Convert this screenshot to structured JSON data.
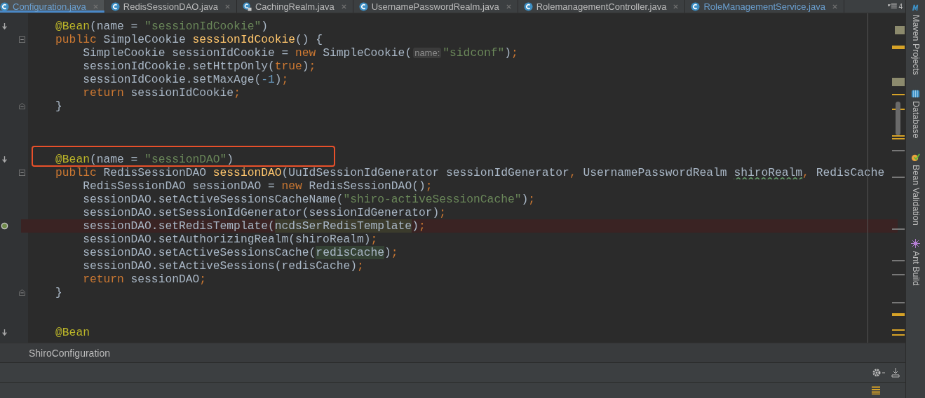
{
  "tabs": [
    {
      "label": "Configuration.java",
      "selected": true,
      "kind": "class",
      "modified": true
    },
    {
      "label": "RedisSessionDAO.java",
      "selected": false,
      "kind": "class",
      "modified": false
    },
    {
      "label": "CachingRealm.java",
      "selected": false,
      "kind": "locked-class",
      "modified": false
    },
    {
      "label": "UsernamePasswordRealm.java",
      "selected": false,
      "kind": "class",
      "modified": false
    },
    {
      "label": "RolemanagementController.java",
      "selected": false,
      "kind": "class",
      "modified": false
    },
    {
      "label": "RoleManagementService.java",
      "selected": false,
      "kind": "class",
      "modified": true
    }
  ],
  "hidden_tab_count": "4",
  "code_lines": [
    {
      "kind": "code",
      "override_marker": true,
      "bean_marker": false,
      "fold_start": false,
      "fold_end": false,
      "breakpoint": false,
      "boxed": false,
      "tokens": [
        {
          "kind": "annotation",
          "text": "    @Bean"
        },
        {
          "kind": "plain",
          "text": "(name = "
        },
        {
          "kind": "string",
          "text": "\"sessionIdCookie\""
        },
        {
          "kind": "plain",
          "text": ")"
        }
      ]
    },
    {
      "kind": "code",
      "override_marker": false,
      "bean_marker": false,
      "fold_start": true,
      "fold_end": false,
      "breakpoint": false,
      "boxed": false,
      "tokens": [
        {
          "kind": "keyword",
          "text": "    public "
        },
        {
          "kind": "plain",
          "text": "SimpleCookie "
        },
        {
          "kind": "method",
          "text": "sessionIdCookie"
        },
        {
          "kind": "plain",
          "text": "() {"
        }
      ]
    },
    {
      "kind": "code",
      "override_marker": false,
      "bean_marker": false,
      "fold_start": false,
      "fold_end": false,
      "breakpoint": false,
      "boxed": false,
      "tokens": [
        {
          "kind": "plain",
          "text": "        SimpleCookie sessionIdCookie = "
        },
        {
          "kind": "keyword",
          "text": "new "
        },
        {
          "kind": "plain",
          "text": "SimpleCookie("
        },
        {
          "kind": "hint",
          "text": "name:"
        },
        {
          "kind": "string",
          "text": "\"sidconf\""
        },
        {
          "kind": "plain",
          "text": ")"
        },
        {
          "kind": "keyword",
          "text": ";"
        }
      ]
    },
    {
      "kind": "code",
      "override_marker": false,
      "bean_marker": false,
      "fold_start": false,
      "fold_end": false,
      "breakpoint": false,
      "boxed": false,
      "tokens": [
        {
          "kind": "plain",
          "text": "        sessionIdCookie.setHttpOnly("
        },
        {
          "kind": "keyword",
          "text": "true"
        },
        {
          "kind": "plain",
          "text": ")"
        },
        {
          "kind": "keyword",
          "text": ";"
        }
      ]
    },
    {
      "kind": "code",
      "override_marker": false,
      "bean_marker": false,
      "fold_start": false,
      "fold_end": false,
      "breakpoint": false,
      "boxed": false,
      "tokens": [
        {
          "kind": "plain",
          "text": "        sessionIdCookie.setMaxAge("
        },
        {
          "kind": "number",
          "text": "-1"
        },
        {
          "kind": "plain",
          "text": ")"
        },
        {
          "kind": "keyword",
          "text": ";"
        }
      ]
    },
    {
      "kind": "code",
      "override_marker": false,
      "bean_marker": false,
      "fold_start": false,
      "fold_end": false,
      "breakpoint": false,
      "boxed": false,
      "tokens": [
        {
          "kind": "keyword",
          "text": "        return "
        },
        {
          "kind": "plain",
          "text": "sessionIdCookie"
        },
        {
          "kind": "keyword",
          "text": ";"
        }
      ]
    },
    {
      "kind": "code",
      "override_marker": false,
      "bean_marker": false,
      "fold_start": false,
      "fold_end": true,
      "breakpoint": false,
      "boxed": false,
      "tokens": [
        {
          "kind": "plain",
          "text": "    }"
        }
      ]
    },
    {
      "kind": "blank"
    },
    {
      "kind": "blank"
    },
    {
      "kind": "blank"
    },
    {
      "kind": "code",
      "override_marker": true,
      "bean_marker": false,
      "fold_start": false,
      "fold_end": false,
      "breakpoint": false,
      "boxed": true,
      "tokens": [
        {
          "kind": "annotation",
          "text": "    @Bean"
        },
        {
          "kind": "plain",
          "text": "(name = "
        },
        {
          "kind": "string",
          "text": "\"sessionDAO\""
        },
        {
          "kind": "plain",
          "text": ")"
        }
      ]
    },
    {
      "kind": "code",
      "override_marker": false,
      "bean_marker": false,
      "fold_start": true,
      "fold_end": false,
      "breakpoint": false,
      "boxed": false,
      "tokens": [
        {
          "kind": "keyword",
          "text": "    public "
        },
        {
          "kind": "plain",
          "text": "RedisSessionDAO "
        },
        {
          "kind": "method",
          "text": "sessionDAO"
        },
        {
          "kind": "plain",
          "text": "(UuIdSessionIdGenerator sessionIdGenerator"
        },
        {
          "kind": "keyword",
          "text": ", "
        },
        {
          "kind": "plain",
          "text": "UsernamePasswordRealm "
        },
        {
          "kind": "typo",
          "text": "shiroRealm"
        },
        {
          "kind": "keyword",
          "text": ", "
        },
        {
          "kind": "plain",
          "text": "RedisCache"
        }
      ]
    },
    {
      "kind": "code",
      "override_marker": false,
      "bean_marker": false,
      "fold_start": false,
      "fold_end": false,
      "breakpoint": false,
      "boxed": false,
      "tokens": [
        {
          "kind": "plain",
          "text": "        RedisSessionDAO sessionDAO = "
        },
        {
          "kind": "keyword",
          "text": "new "
        },
        {
          "kind": "plain",
          "text": "RedisSessionDAO()"
        },
        {
          "kind": "keyword",
          "text": ";"
        }
      ]
    },
    {
      "kind": "code",
      "override_marker": false,
      "bean_marker": false,
      "fold_start": false,
      "fold_end": false,
      "breakpoint": false,
      "boxed": false,
      "tokens": [
        {
          "kind": "plain",
          "text": "        sessionDAO.setActiveSessionsCacheName("
        },
        {
          "kind": "string",
          "text": "\"shiro-activeSessionCache\""
        },
        {
          "kind": "plain",
          "text": ")"
        },
        {
          "kind": "keyword",
          "text": ";"
        }
      ]
    },
    {
      "kind": "code",
      "override_marker": false,
      "bean_marker": false,
      "fold_start": false,
      "fold_end": false,
      "breakpoint": false,
      "boxed": false,
      "tokens": [
        {
          "kind": "plain",
          "text": "        sessionDAO.setSessionIdGenerator(sessionIdGenerator)"
        },
        {
          "kind": "keyword",
          "text": ";"
        }
      ]
    },
    {
      "kind": "code",
      "override_marker": false,
      "bean_marker": true,
      "fold_start": false,
      "fold_end": false,
      "breakpoint": true,
      "boxed": false,
      "tokens": [
        {
          "kind": "plain",
          "text": "        sessionDAO.setRedisTemplate("
        },
        {
          "kind": "reference",
          "text": "ncdsSerRedisTemplate"
        },
        {
          "kind": "plain",
          "text": ")"
        },
        {
          "kind": "keyword",
          "text": ";"
        }
      ]
    },
    {
      "kind": "code",
      "override_marker": false,
      "bean_marker": false,
      "fold_start": false,
      "fold_end": false,
      "breakpoint": false,
      "boxed": false,
      "tokens": [
        {
          "kind": "plain",
          "text": "        sessionDAO.setAuthorizingRealm(shiroRealm)"
        },
        {
          "kind": "keyword",
          "text": ";"
        }
      ]
    },
    {
      "kind": "code",
      "override_marker": false,
      "bean_marker": false,
      "fold_start": false,
      "fold_end": false,
      "breakpoint": false,
      "boxed": false,
      "tokens": [
        {
          "kind": "plain",
          "text": "        sessionDAO.setActiveSessionsCache("
        },
        {
          "kind": "usage",
          "text": "redisCache"
        },
        {
          "kind": "plain",
          "text": ")"
        },
        {
          "kind": "keyword",
          "text": ";"
        }
      ]
    },
    {
      "kind": "code",
      "override_marker": false,
      "bean_marker": false,
      "fold_start": false,
      "fold_end": false,
      "breakpoint": false,
      "boxed": false,
      "tokens": [
        {
          "kind": "plain",
          "text": "        sessionDAO.setActiveSessions(redisCache)"
        },
        {
          "kind": "keyword",
          "text": ";"
        }
      ]
    },
    {
      "kind": "code",
      "override_marker": false,
      "bean_marker": false,
      "fold_start": false,
      "fold_end": false,
      "breakpoint": false,
      "boxed": false,
      "tokens": [
        {
          "kind": "keyword",
          "text": "        return "
        },
        {
          "kind": "plain",
          "text": "sessionDAO"
        },
        {
          "kind": "keyword",
          "text": ";"
        }
      ]
    },
    {
      "kind": "code",
      "override_marker": false,
      "bean_marker": false,
      "fold_start": false,
      "fold_end": true,
      "breakpoint": false,
      "boxed": false,
      "tokens": [
        {
          "kind": "plain",
          "text": "    }"
        }
      ]
    },
    {
      "kind": "blank"
    },
    {
      "kind": "blank"
    },
    {
      "kind": "code",
      "override_marker": true,
      "bean_marker": false,
      "fold_start": false,
      "fold_end": false,
      "breakpoint": false,
      "boxed": false,
      "tokens": [
        {
          "kind": "annotation",
          "text": "    @Bean"
        }
      ]
    }
  ],
  "breadcrumb": "ShiroConfiguration",
  "tool_windows": [
    {
      "label": "Maven Projects",
      "kind": "maven"
    },
    {
      "label": "Database",
      "kind": "database"
    },
    {
      "label": "Bean Validation",
      "kind": "bean"
    },
    {
      "label": "Ant Build",
      "kind": "ant"
    }
  ]
}
